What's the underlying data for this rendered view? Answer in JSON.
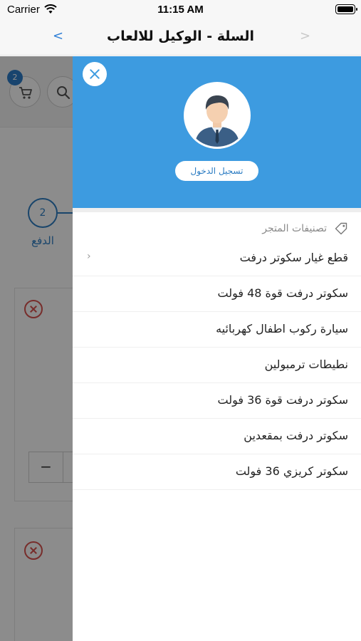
{
  "status_bar": {
    "carrier": "Carrier",
    "time": "11:15 AM"
  },
  "nav": {
    "title": "السلة - الوكيل للالعاب",
    "back_glyph": "<",
    "forward_glyph": ">"
  },
  "background": {
    "cart_badge_count": "2",
    "step_number": "2",
    "step_label": "الدفع",
    "qty_minus": "−"
  },
  "drawer": {
    "login_label": "تسجيل الدخول",
    "categories_title": "تصنيفات المتجر",
    "categories": [
      {
        "label": "قطع غيار سكوتر درفت",
        "has_children": true
      },
      {
        "label": "سكوتر درفت قوة 48 فولت",
        "has_children": false
      },
      {
        "label": "سيارة ركوب اطفال كهربائيه",
        "has_children": false
      },
      {
        "label": "نطيطات ترمبولين",
        "has_children": false
      },
      {
        "label": "سكوتر درفت قوة 36 فولت",
        "has_children": false
      },
      {
        "label": "سكوتر درفت بمقعدين",
        "has_children": false
      },
      {
        "label": "سكوتر كريزي 36 فولت",
        "has_children": false
      }
    ],
    "chevron_glyph": "›"
  },
  "colors": {
    "drawer_header": "#3d9be0",
    "accent_blue": "#2f7fc4",
    "remove_red": "#d9534f"
  },
  "icons": [
    "wifi-icon",
    "battery-icon",
    "close-icon",
    "avatar-icon",
    "tag-icon",
    "cart-icon",
    "search-icon",
    "chevron-left-icon",
    "remove-icon"
  ]
}
